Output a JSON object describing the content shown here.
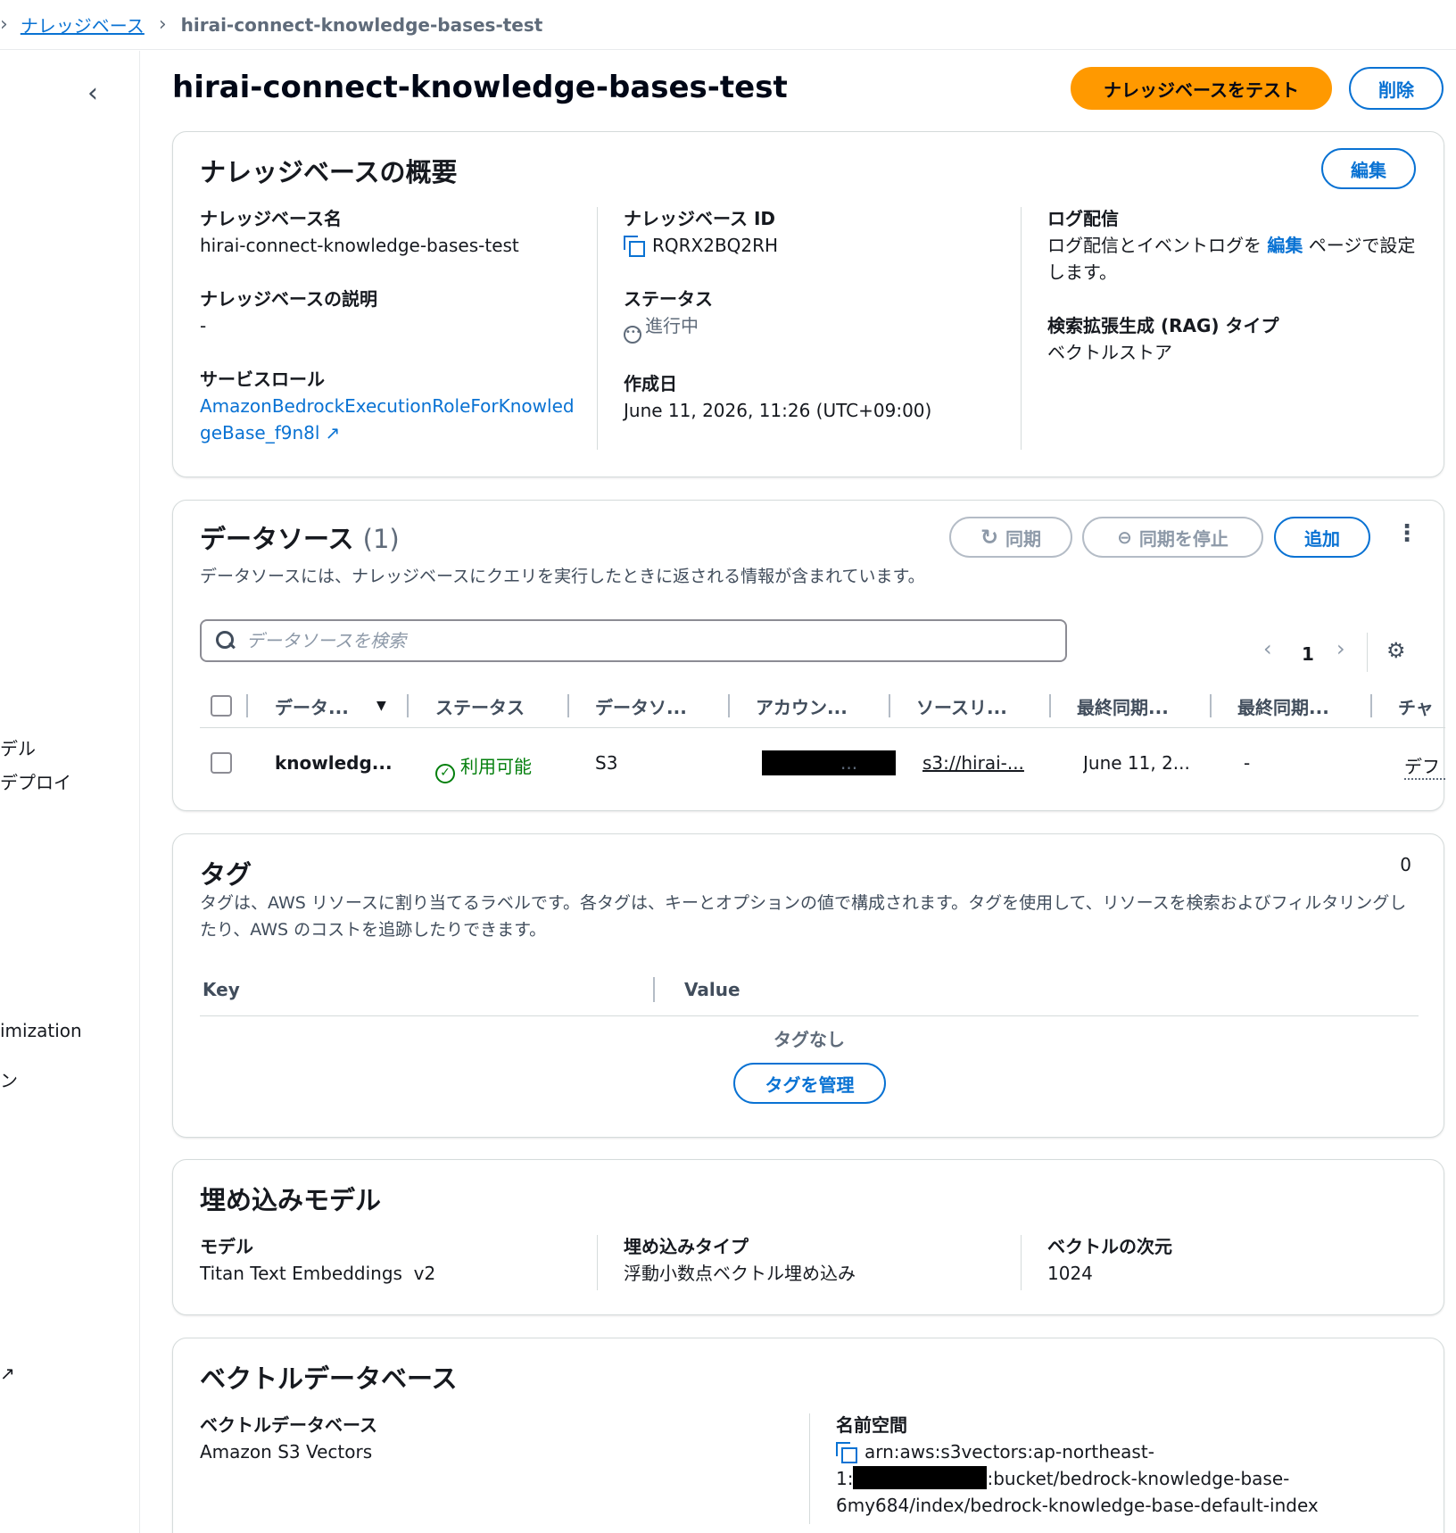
{
  "breadcrumb": {
    "items": [
      "ナレッジベース",
      "hirai-connect-knowledge-bases-test"
    ]
  },
  "left_nav": {
    "fragments": [
      "デル",
      "デプロイ",
      "imization",
      "ン",
      "↗"
    ]
  },
  "header": {
    "title": "hirai-connect-knowledge-bases-test",
    "test_button": "ナレッジベースをテスト",
    "delete_button": "削除"
  },
  "overview": {
    "title": "ナレッジベースの概要",
    "edit_button": "編集",
    "kb_name_label": "ナレッジベース名",
    "kb_name_value": "hirai-connect-knowledge-bases-test",
    "kb_desc_label": "ナレッジベースの説明",
    "kb_desc_value": "-",
    "service_role_label": "サービスロール",
    "service_role_value": "AmazonBedrockExecutionRoleForKnowledgeBase_f9n8l",
    "kb_id_label": "ナレッジベース ID",
    "kb_id_value": "RQRX2BQ2RH",
    "status_label": "ステータス",
    "status_value": "進行中",
    "created_label": "作成日",
    "created_value": "June 11, 2026, 11:26 (UTC+09:00)",
    "log_label": "ログ配信",
    "log_text_before": "ログ配信とイベントログを",
    "log_link": "編集",
    "log_text_after": "ページで設定します。",
    "rag_label": "検索拡張生成 (RAG) タイプ",
    "rag_value": "ベクトルストア"
  },
  "datasource": {
    "title": "データソース",
    "count": "(1)",
    "sync_button": "同期",
    "stop_button": "同期を停止",
    "add_button": "追加",
    "description": "データソースには、ナレッジベースにクエリを実行したときに返される情報が含まれています。",
    "search_placeholder": "データソースを検索",
    "page": "1",
    "columns": [
      "データ...",
      "ステータス",
      "データソ...",
      "アカウン...",
      "ソースリ...",
      "最終同期...",
      "最終同期...",
      "チャ"
    ],
    "row": {
      "name": "knowledg...",
      "status": "利用可能",
      "type": "S3",
      "account": "...",
      "source": "s3://hirai-...",
      "last_sync": "June 11, 2...",
      "last_sync2": "-",
      "chunk": "デフ"
    }
  },
  "tags": {
    "title": "タグ",
    "count": "0",
    "description": "タグは、AWS リソースに割り当てるラベルです。各タグは、キーとオプションの値で構成されます。タグを使用して、リソースを検索およびフィルタリングしたり、AWS のコストを追跡したりできます。",
    "key_header": "Key",
    "value_header": "Value",
    "empty": "タグなし",
    "manage_button": "タグを管理"
  },
  "embedding": {
    "title": "埋め込みモデル",
    "model_label": "モデル",
    "model_value": "Titan Text Embeddings  v2",
    "type_label": "埋め込みタイプ",
    "type_value": "浮動小数点ベクトル埋め込み",
    "dim_label": "ベクトルの次元",
    "dim_value": "1024"
  },
  "vectordb": {
    "title": "ベクトルデータベース",
    "db_label": "ベクトルデータベース",
    "db_value": "Amazon S3 Vectors",
    "ns_label": "名前空間",
    "ns_line1": "arn:aws:s3vectors:ap-northeast-",
    "ns_line2_prefix": "1:",
    "ns_line2_suffix": ":bucket/bedrock-knowledge-base-",
    "ns_line3": "6my684/index/bedrock-knowledge-base-default-index"
  },
  "colors": {
    "link": "#0972d3",
    "primary_button": "#ff9900",
    "success": "#037f0c"
  }
}
